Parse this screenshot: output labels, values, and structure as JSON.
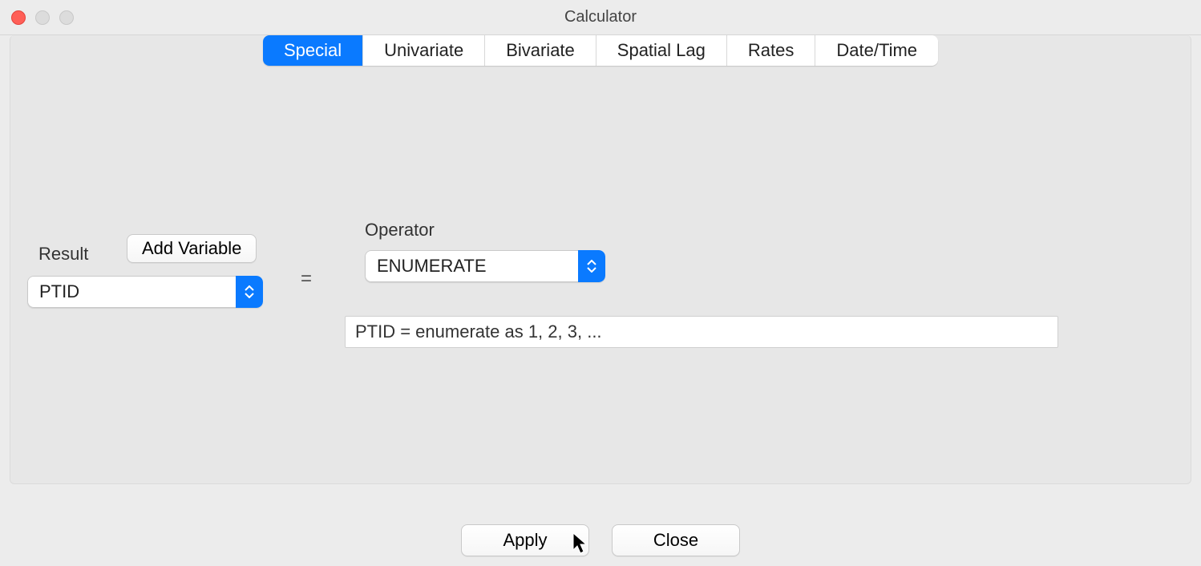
{
  "window": {
    "title": "Calculator"
  },
  "tabs": {
    "items": [
      "Special",
      "Univariate",
      "Bivariate",
      "Spatial Lag",
      "Rates",
      "Date/Time"
    ],
    "active_index": 0
  },
  "form": {
    "result_label": "Result",
    "add_variable_label": "Add Variable",
    "result_value": "PTID",
    "equals": "=",
    "operator_label": "Operator",
    "operator_value": "ENUMERATE",
    "preview": "PTID = enumerate as 1, 2, 3, ..."
  },
  "buttons": {
    "apply": "Apply",
    "close": "Close"
  }
}
